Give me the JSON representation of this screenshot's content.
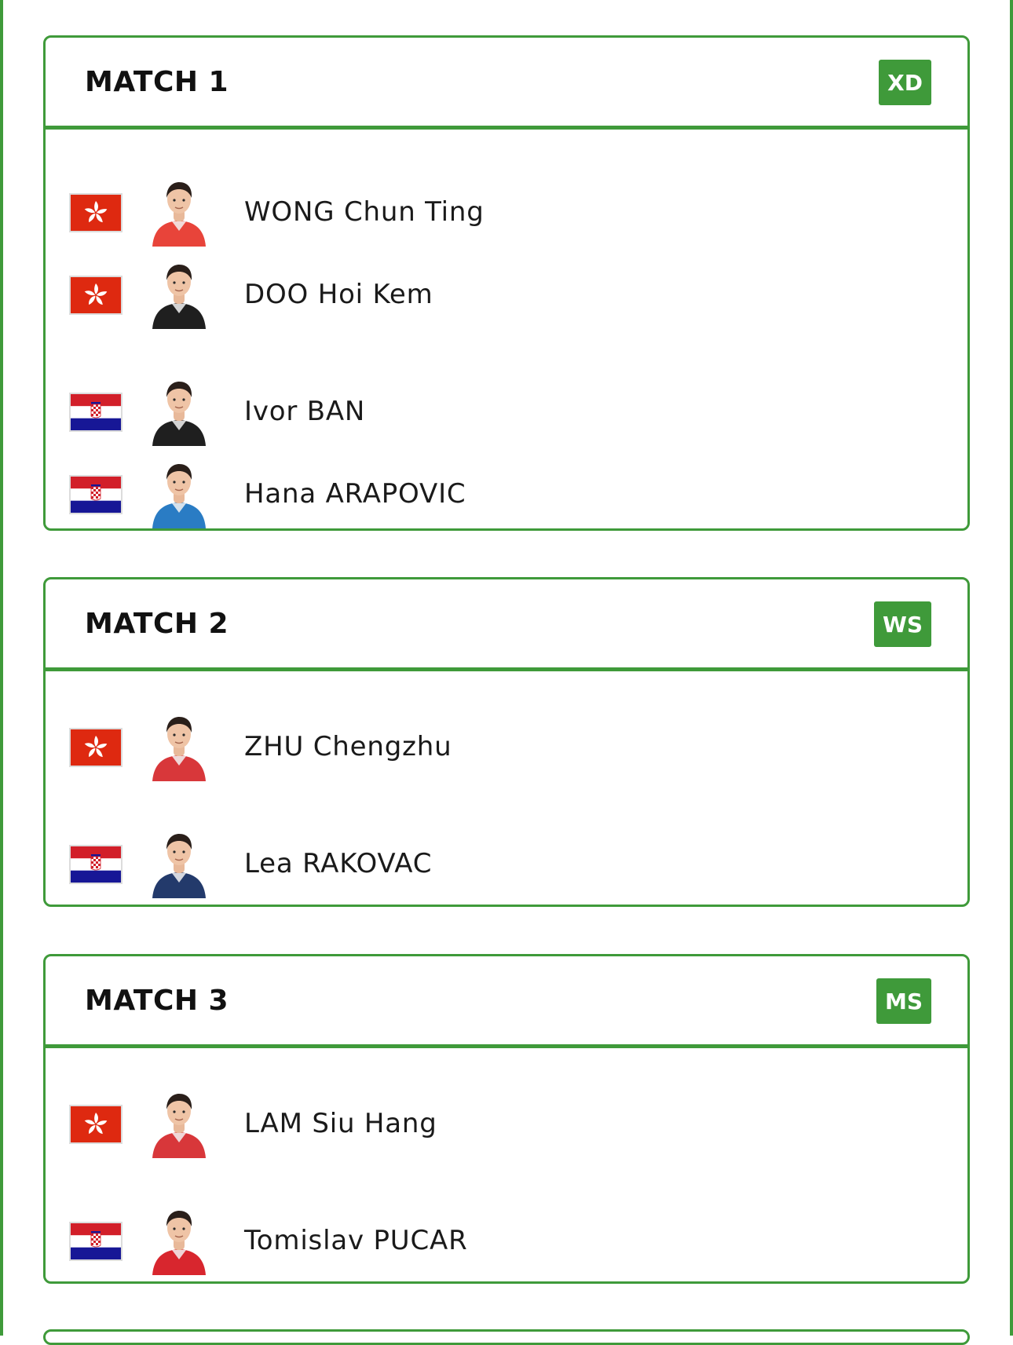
{
  "matches": [
    {
      "title": "MATCH 1",
      "badge": "XD",
      "players": [
        {
          "name": "WONG Chun Ting",
          "flag": "hong-kong",
          "kit_color": "#e8443a"
        },
        {
          "name": "DOO Hoi Kem",
          "flag": "hong-kong",
          "kit_color": "#1f1f1f"
        },
        {
          "name": "Ivor BAN",
          "flag": "croatia",
          "kit_color": "#1f1f1f"
        },
        {
          "name": "Hana ARAPOVIC",
          "flag": "croatia",
          "kit_color": "#2a7cc4"
        }
      ]
    },
    {
      "title": "MATCH 2",
      "badge": "WS",
      "players": [
        {
          "name": "ZHU Chengzhu",
          "flag": "hong-kong",
          "kit_color": "#d8373a"
        },
        {
          "name": "Lea RAKOVAC",
          "flag": "croatia",
          "kit_color": "#233a6b"
        }
      ]
    },
    {
      "title": "MATCH 3",
      "badge": "MS",
      "players": [
        {
          "name": "LAM Siu Hang",
          "flag": "hong-kong",
          "kit_color": "#d8373a"
        },
        {
          "name": "Tomislav PUCAR",
          "flag": "croatia",
          "kit_color": "#d8262e"
        }
      ]
    }
  ],
  "colors": {
    "accent": "#3f9a3a",
    "hk_red": "#de2910",
    "hr_red": "#d21f29",
    "hr_blue": "#171796"
  }
}
